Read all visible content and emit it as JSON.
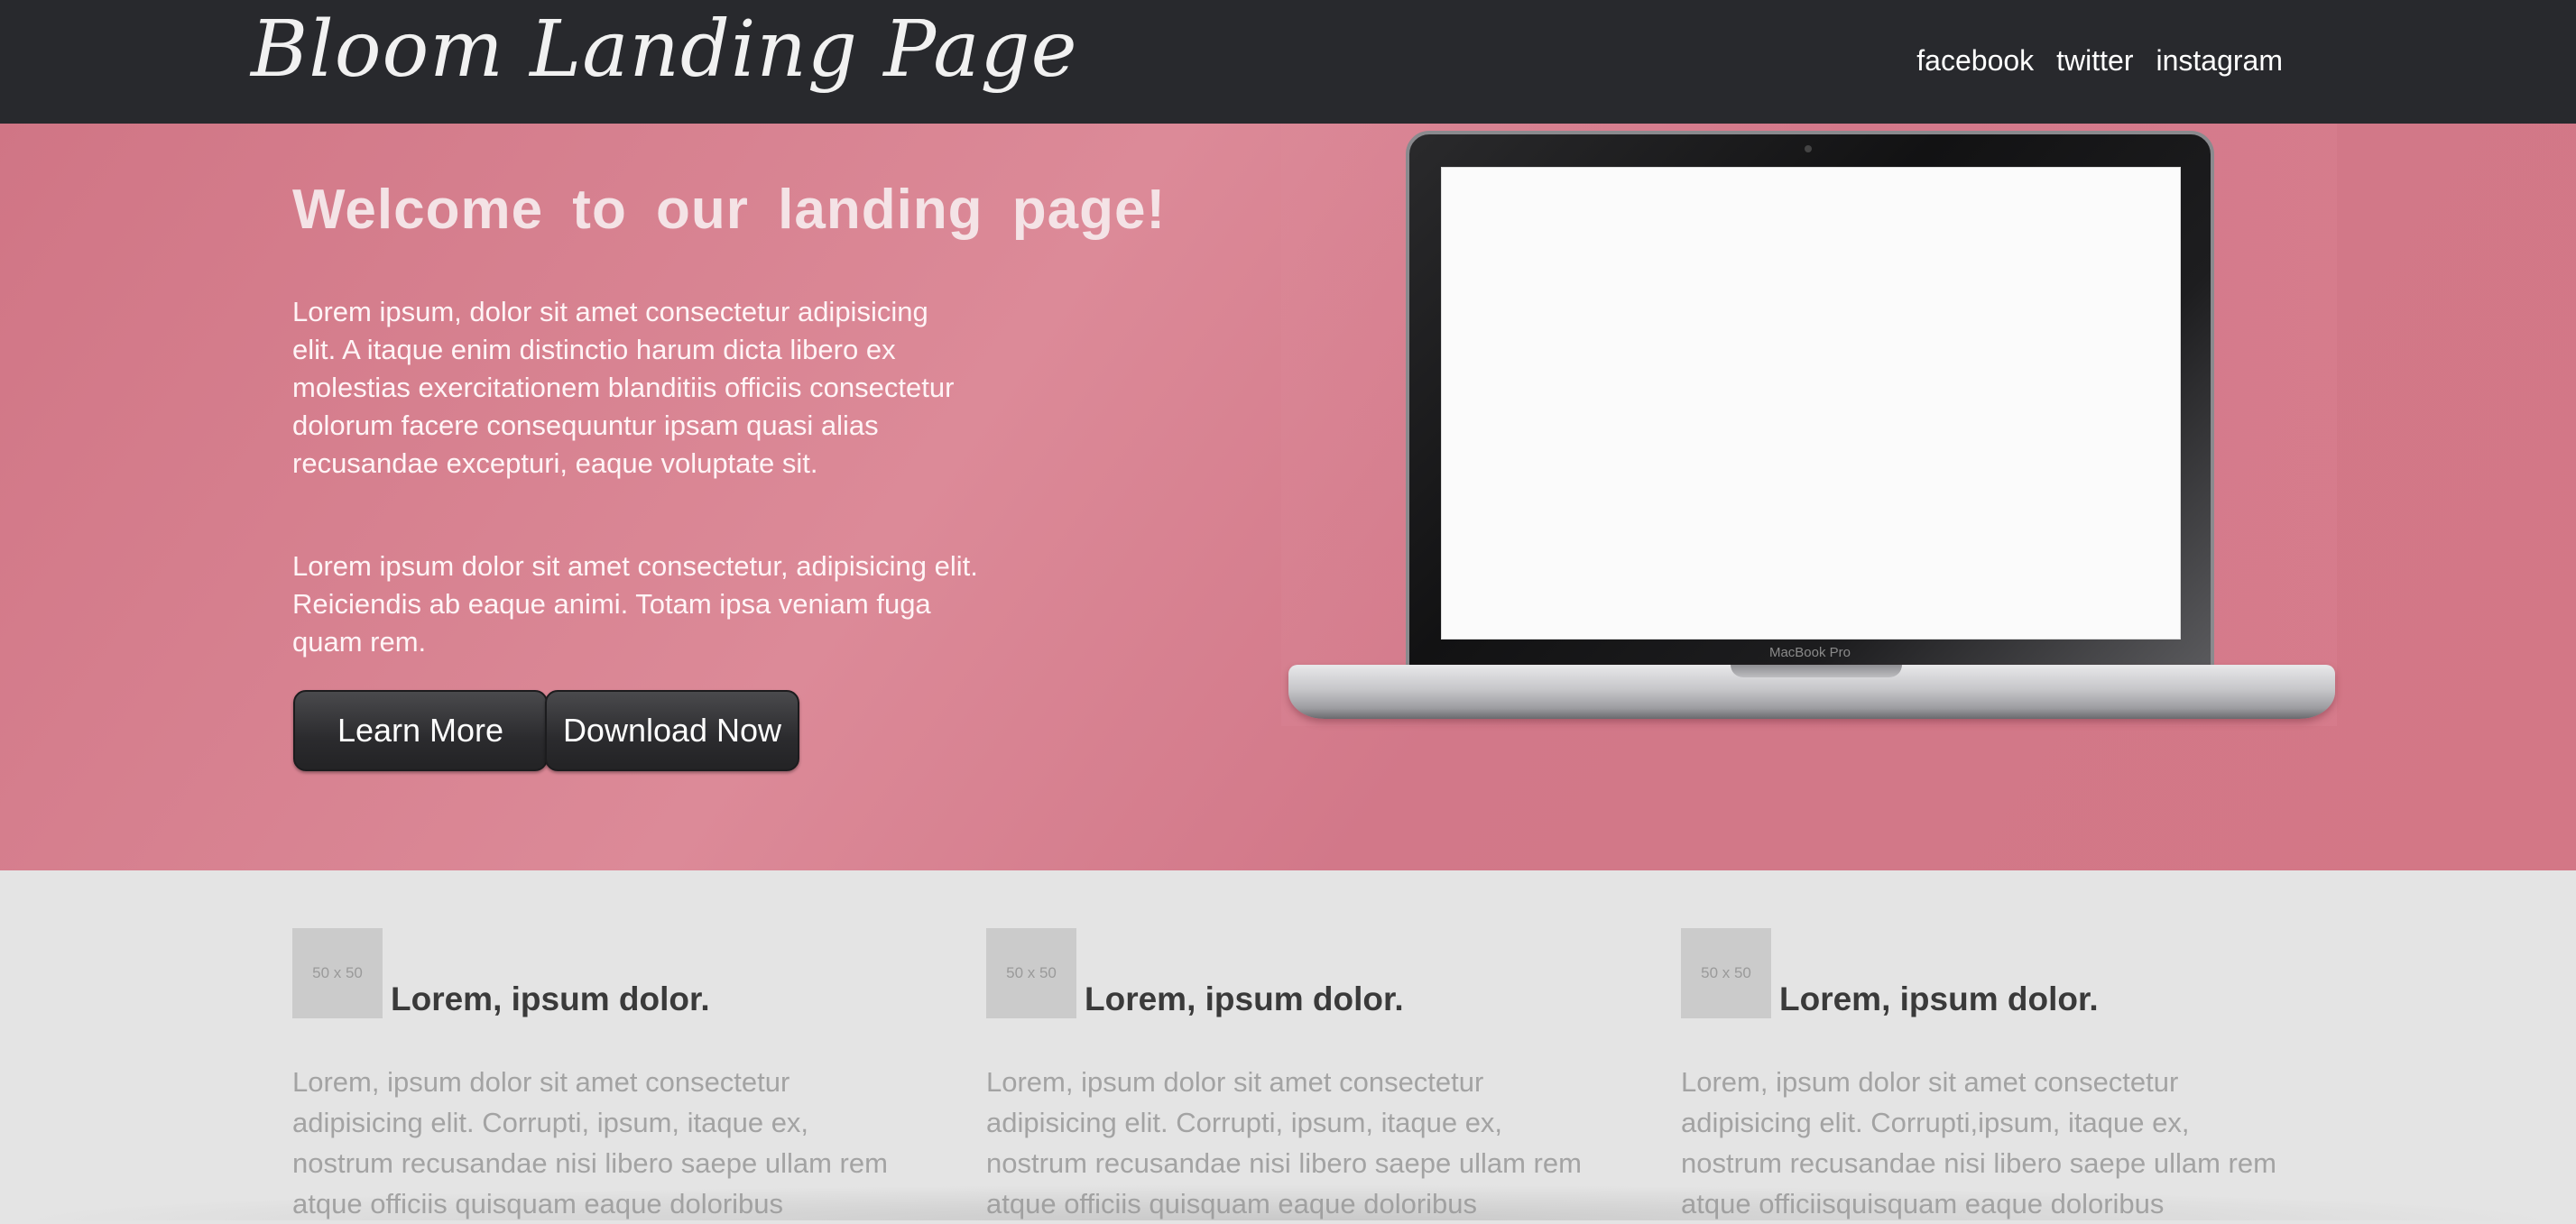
{
  "header": {
    "logo": "Bloom Landing Page",
    "social": [
      "facebook",
      "twitter",
      "instagram"
    ]
  },
  "hero": {
    "title": "Welcome to our landing page!",
    "paragraphs": [
      "Lorem ipsum, dolor sit amet consectetur adipisicing elit. A itaque enim distinctio harum dicta libero ex molestias exercitationem blanditiis officiis consectetur dolorum facere consequuntur ipsam quasi alias recusandae excepturi, eaque voluptate sit.",
      "Lorem ipsum dolor sit amet consectetur, adipisicing elit. Reiciendis ab eaque animi. Totam ipsa veniam fuga quam rem."
    ],
    "learn_more": "Learn More",
    "download_now": "Download Now",
    "laptop_brand": "MacBook Pro"
  },
  "features": [
    {
      "thumb": "50 x 50",
      "title": "Lorem, ipsum dolor.",
      "text": "Lorem, ipsum dolor sit amet consectetur adipisicing elit. Corrupti, ipsum, itaque ex, nostrum recusandae nisi libero saepe ullam rem atque officiis quisquam eaque doloribus"
    },
    {
      "thumb": "50 x 50",
      "title": "Lorem, ipsum dolor.",
      "text": "Lorem, ipsum dolor sit amet consectetur adipisicing elit. Corrupti, ipsum, itaque ex, nostrum recusandae nisi libero saepe ullam rem atque officiis quisquam eaque doloribus"
    },
    {
      "thumb": "50 x 50",
      "title": "Lorem, ipsum dolor.",
      "text": "Lorem, ipsum dolor sit amet consectetur adipisicing elit. Corrupti,ipsum, itaque ex, nostrum recusandae nisi libero saepe ullam rem atque officiisquisquam eaque doloribus"
    }
  ],
  "colors": {
    "header_bg": "#28292d",
    "hero_bg": "#d37786",
    "features_bg": "#e4e4e4",
    "button_bg": "#2b2b2e"
  }
}
